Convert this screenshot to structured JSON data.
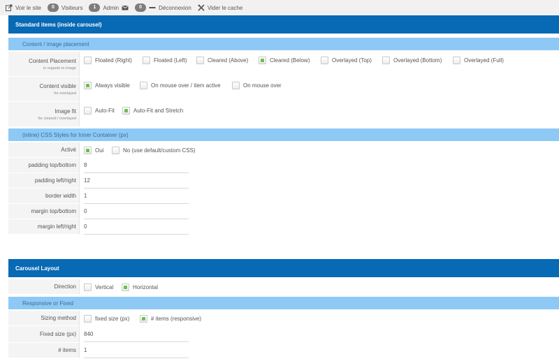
{
  "adminbar": {
    "view_site": "Voir le site",
    "visitors_count": "0",
    "visitors": "Visiteurs",
    "admin_count": "1",
    "admin": "Admin",
    "logout_count": "0",
    "logout": "Déconnexion",
    "clear_cache": "Vider le cache"
  },
  "standard": {
    "title": "Standard items (inside carousel)",
    "content_placement_header": "Content / image placement",
    "placement": {
      "label": "Content Placement",
      "sublabel": "in regards to image",
      "options": [
        "Floated (Right)",
        "Floated (Left)",
        "Cleared (Above)",
        "Cleared (Below)",
        "Overlayed (Top)",
        "Overlayed (Bottom)",
        "Overlayed (Full)"
      ],
      "selected": 3
    },
    "visible": {
      "label": "Content visible",
      "sublabel": "for overlayed",
      "options": [
        "Always visible",
        "On mouse over / item active",
        "On mouse over"
      ],
      "selected": 0
    },
    "fit": {
      "label": "Image fit",
      "sublabel": "for cleared / overlayed",
      "options": [
        "Auto-Fit",
        "Auto-Fit and Stretch"
      ],
      "selected": 1
    },
    "css_header": "(inline) CSS Styles for Inner Container (px)",
    "active": {
      "label": "Activé",
      "options": [
        "Oui",
        "No (use default/custom CSS)"
      ],
      "selected": 0
    },
    "padding_tb": {
      "label": "padding top/bottom",
      "value": "8"
    },
    "padding_lr": {
      "label": "padding left/right",
      "value": "12"
    },
    "border_width": {
      "label": "border width",
      "value": "1"
    },
    "margin_tb": {
      "label": "margin top/bottom",
      "value": "0"
    },
    "margin_lr": {
      "label": "margin left/right",
      "value": "0"
    }
  },
  "carousel": {
    "title": "Carousel Layout",
    "direction": {
      "label": "Direction",
      "options": [
        "Vertical",
        "Horizontal"
      ],
      "selected": 1
    },
    "responsive_header": "Responsive or Fixed",
    "sizing": {
      "label": "Sizing method",
      "options": [
        "fixed size (px)",
        "# items (responsive)"
      ],
      "selected": 1
    },
    "fixed_size": {
      "label": "Fixed size (px)",
      "value": "840"
    },
    "items": {
      "label": "# items",
      "value": "1"
    }
  },
  "colors": {
    "header": "#0869b4",
    "subheader": "#8ec9f5",
    "checked": "#6bc04b"
  }
}
